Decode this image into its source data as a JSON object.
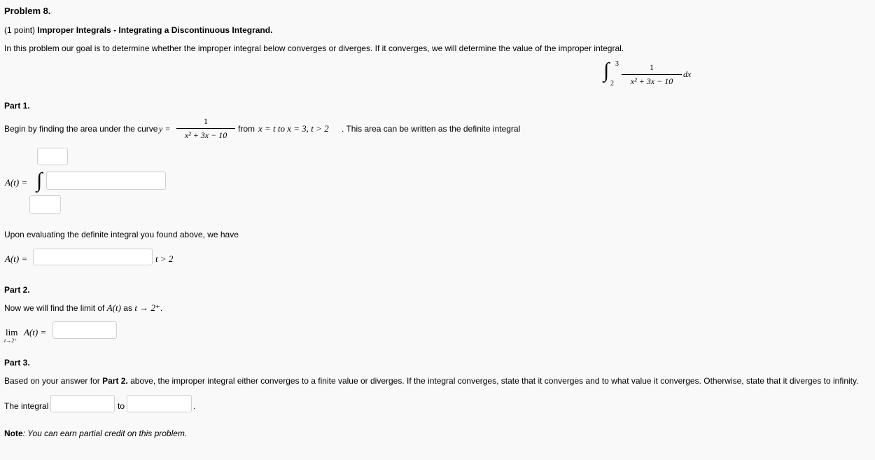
{
  "problem": {
    "title": "Problem 8.",
    "points": "(1 point)",
    "heading": "Improper Integrals - Integrating a Discontinuous Integrand.",
    "intro": "In this problem our goal is to determine whether the improper integral below converges or diverges. If it converges, we will determine the value of the improper integral.",
    "display_integral": {
      "upper": "3",
      "lower": "2",
      "numerator": "1",
      "denominator": "x² + 3x − 10",
      "differential": "dx"
    }
  },
  "part1": {
    "label": "Part 1.",
    "sentence_start": "Begin by finding the area under the curve",
    "y_eq": "y =",
    "frac_num": "1",
    "frac_den": "x² + 3x − 10",
    "sentence_mid": "from",
    "bounds_math": "x = t to x = 3, t > 2",
    "sentence_end": ". This area can be written as the definite integral",
    "at_label": "A(t) =",
    "upper_limit_value": "",
    "integrand_value": "",
    "lower_limit_value": "",
    "evaluate_text": "Upon evaluating the definite integral you found above, we have",
    "at_label2": "A(t) =",
    "at_value": "",
    "condition": "t > 2"
  },
  "part2": {
    "label": "Part 2.",
    "sentence": "Now we will find the limit of",
    "sentence_math": "A(t)",
    "sentence_as": "as",
    "sentence_limit": "t → 2⁺",
    "lim_word": "lim",
    "lim_sub": "t→2⁺",
    "lim_rest": "A(t) =",
    "lim_value": ""
  },
  "part3": {
    "label": "Part 3.",
    "sentence_pre": "Based on your answer for",
    "sentence_bold": "Part 2.",
    "sentence_post": "above, the improper integral either converges to a finite value or diverges. If the integral converges, state that it converges and to what value it converges. Otherwise, state that it diverges to infinity.",
    "the_integral": "The integral",
    "to_word": "to",
    "first_value": "",
    "second_value": ""
  },
  "note": {
    "label": "Note",
    "text": ": You can earn partial credit on this problem."
  }
}
